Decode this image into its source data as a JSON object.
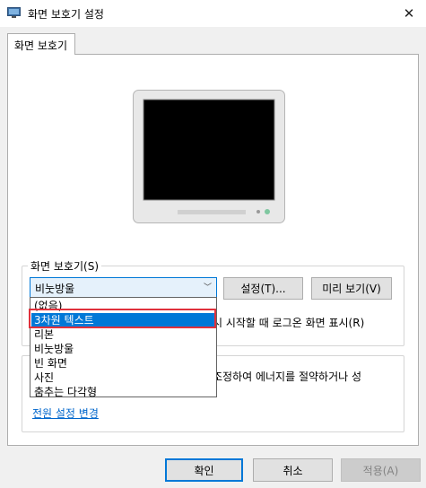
{
  "window": {
    "title": "화면 보호기 설정",
    "close_label": "✕"
  },
  "tab": {
    "label": "화면 보호기"
  },
  "screensaver_group": {
    "label": "화면 보호기(S)",
    "selected_value": "비눗방울",
    "settings_button": "설정(T)...",
    "preview_button": "미리 보기(V)",
    "logon_text": "시 시작할 때 로그온 화면 표시(R)"
  },
  "dropdown": {
    "options": [
      "(없음)",
      "3차원 텍스트",
      "리본",
      "비눗방울",
      "빈 화면",
      "사진",
      "춤추는 다각형"
    ],
    "highlighted_index": 1
  },
  "power_group": {
    "text_line1": "조정하여 에너지를 절약하거나 성",
    "text_line2": "",
    "link": "전원 설정 변경"
  },
  "footer": {
    "ok": "확인",
    "cancel": "취소",
    "apply": "적용(A)"
  },
  "colors": {
    "accent": "#0078d7",
    "highlight_border": "#e0313c",
    "link": "#0066cc"
  }
}
